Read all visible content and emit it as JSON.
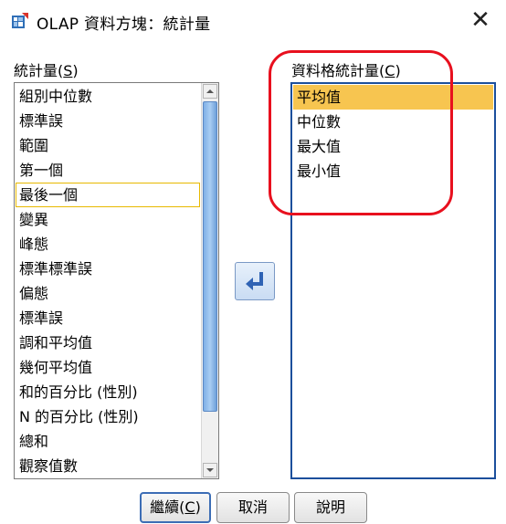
{
  "window": {
    "title": "OLAP 資料方塊：統計量"
  },
  "statistics_panel": {
    "label_text": "統計量",
    "label_mnemonic": "S",
    "items": [
      "組別中位數",
      "標準誤",
      "範圍",
      "第一個",
      "最後一個",
      "變異",
      "峰態",
      "標準標準誤",
      "偏態",
      "標準誤",
      "調和平均值",
      "幾何平均值",
      "和的百分比 (性別)",
      "N 的百分比 (性別)",
      "總和",
      "觀察值數"
    ],
    "focused_item": "最後一個"
  },
  "cell_statistics_panel": {
    "label_text": "資料格統計量",
    "label_mnemonic": "C",
    "items": [
      "平均值",
      "中位數",
      "最大值",
      "最小值"
    ],
    "selected_item": "平均值"
  },
  "buttons": {
    "continue_text": "繼續",
    "continue_mnemonic": "C",
    "cancel": "取消",
    "help": "說明"
  },
  "colors": {
    "selection": "#f7c550",
    "annotation": "#e8101e",
    "list_border": "#1c4f9c"
  }
}
